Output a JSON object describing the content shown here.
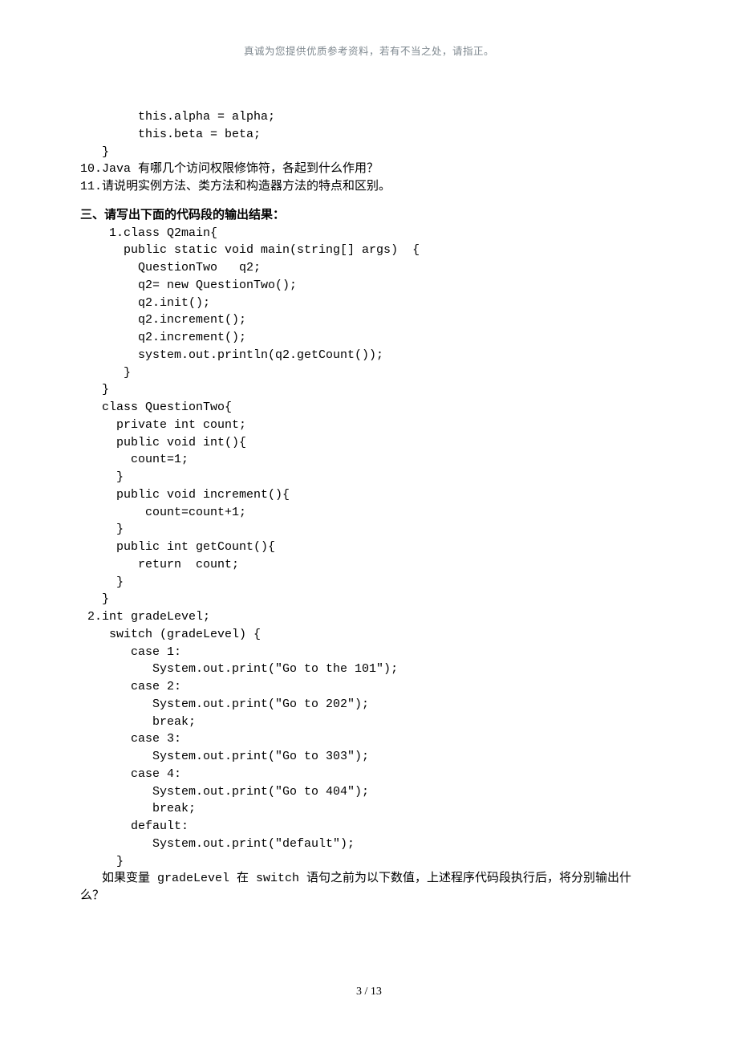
{
  "header": "真诚为您提供优质参考资料，若有不当之处，请指正。",
  "pre_lines": [
    "        this.alpha = alpha;",
    "        this.beta = beta;",
    "   }"
  ],
  "q10": "10.Java 有哪几个访问权限修饰符，各起到什么作用？",
  "q11": "11.请说明实例方法、类方法和构造器方法的特点和区别。",
  "section3_title": "三、请写出下面的代码段的输出结果：",
  "code1": [
    "    1.class Q2main{",
    "      public static void main(string[] args)  {",
    "        QuestionTwo   q2;",
    "        q2= new QuestionTwo();",
    "        q2.init();",
    "        q2.increment();",
    "        q2.increment();",
    "        system.out.println(q2.getCount());",
    "      }",
    "   }",
    "   class QuestionTwo{",
    "     private int count;",
    "     public void int(){",
    "       count=1;",
    "     }",
    "     public void increment(){",
    "         count=count+1;",
    "     }",
    "     public int getCount(){",
    "        return  count;",
    "     }",
    "   }",
    " 2.int gradeLevel;",
    "    switch (gradeLevel) {",
    "       case 1:",
    "          System.out.print(\"Go to the 101\");",
    "       case 2:",
    "          System.out.print(\"Go to 202\");",
    "          break;",
    "       case 3:",
    "          System.out.print(\"Go to 303\");",
    "       case 4:",
    "          System.out.print(\"Go to 404\");",
    "          break;",
    "       default:",
    "          System.out.print(\"default\");",
    "     }"
  ],
  "followup_a": "   如果变量 gradeLevel 在 switch 语句之前为以下数值，上述程序代码段执行后，将分别输出什",
  "followup_b": "么？",
  "footer": "3 / 13"
}
